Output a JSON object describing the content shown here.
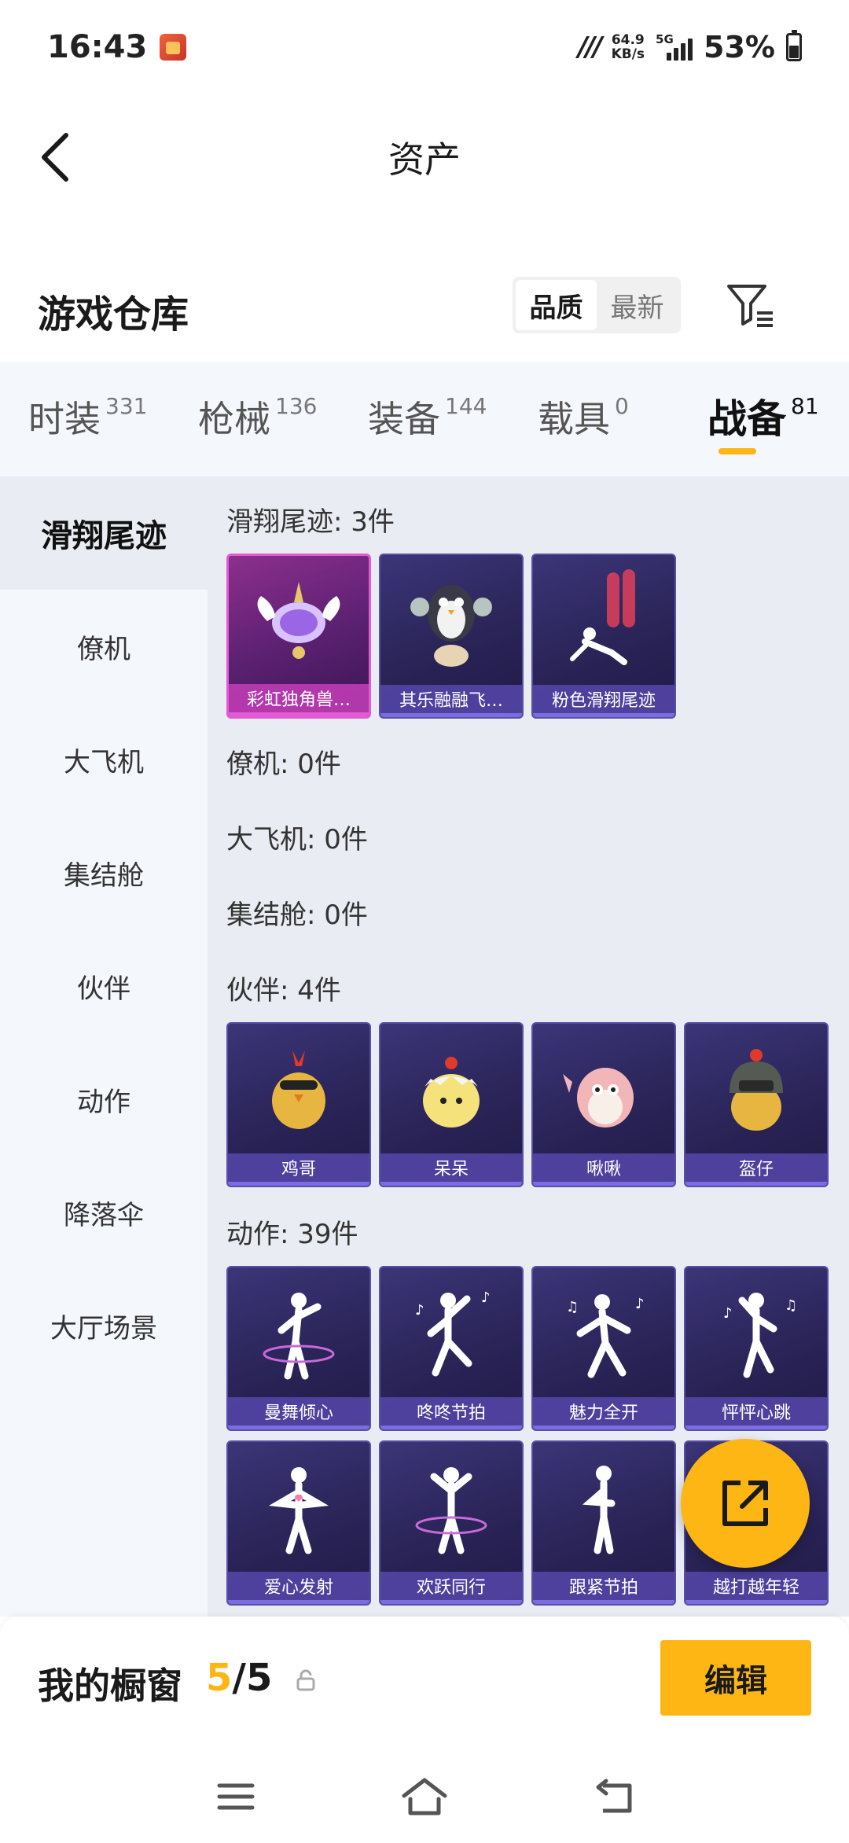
{
  "status_bar": {
    "time": "16:43",
    "net_speed_value": "64.9",
    "net_speed_unit": "KB/s",
    "network_type": "5G",
    "battery_percent": "53%",
    "battery_level": 0.53
  },
  "header": {
    "title": "资产"
  },
  "warehouse": {
    "title": "游戏仓库",
    "sort_options": [
      "品质",
      "最新"
    ],
    "sort_selected": "品质"
  },
  "categories": [
    {
      "label": "时装",
      "count": "331"
    },
    {
      "label": "枪械",
      "count": "136"
    },
    {
      "label": "装备",
      "count": "144"
    },
    {
      "label": "载具",
      "count": "0"
    },
    {
      "label": "战备",
      "count": "81"
    }
  ],
  "categories_active": "战备",
  "sidebar": {
    "items": [
      "滑翔尾迹",
      "僚机",
      "大飞机",
      "集结舱",
      "伙伴",
      "动作",
      "降落伞",
      "大厅场景"
    ],
    "active": "滑翔尾迹"
  },
  "sections": {
    "glide": {
      "title": "滑翔尾迹: 3件",
      "items": [
        "彩虹独角兽…",
        "其乐融融飞…",
        "粉色滑翔尾迹"
      ]
    },
    "wingman": {
      "title": "僚机: 0件"
    },
    "plane": {
      "title": "大飞机: 0件"
    },
    "pod": {
      "title": "集结舱: 0件"
    },
    "companion": {
      "title": "伙伴: 4件",
      "items": [
        "鸡哥",
        "呆呆",
        "啾啾",
        "盔仔"
      ]
    },
    "emote": {
      "title": "动作: 39件",
      "items": [
        "曼舞倾心",
        "咚咚节拍",
        "魅力全开",
        "怦怦心跳",
        "爱心发射",
        "欢跃同行",
        "跟紧节拍",
        "越打越年轻"
      ]
    }
  },
  "showcase": {
    "title": "我的橱窗",
    "current": "5",
    "separator": "/",
    "max": "5",
    "edit_label": "编辑"
  },
  "colors": {
    "accent": "#fdb614",
    "card_purple": "#2a2458",
    "card_pink": "#8c2f8e"
  }
}
